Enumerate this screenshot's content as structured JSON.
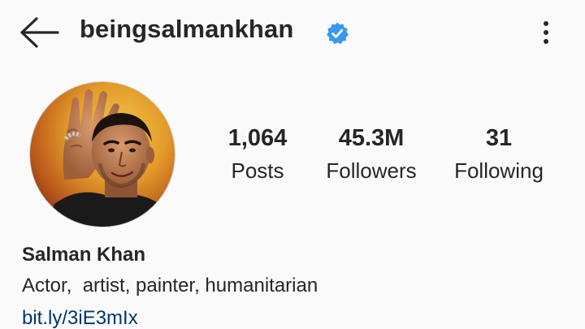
{
  "header": {
    "back_icon": "arrow-left-icon",
    "username": "beingsalmankhan",
    "verified_icon": "verified-badge-icon",
    "more_icon": "more-vertical-icon"
  },
  "profile": {
    "avatar": "profile-photo"
  },
  "stats": {
    "posts": {
      "value": "1,064",
      "label": "Posts"
    },
    "followers": {
      "value": "45.3M",
      "label": "Followers"
    },
    "following": {
      "value": "31",
      "label": "Following"
    }
  },
  "bio": {
    "full_name": "Salman Khan",
    "description": "Actor,  artist, painter, humanitarian",
    "link": "bit.ly/3iE3mIx"
  },
  "colors": {
    "background": "#fafafa",
    "text": "#262626",
    "link": "#00376b",
    "verified": "#3897f0"
  }
}
